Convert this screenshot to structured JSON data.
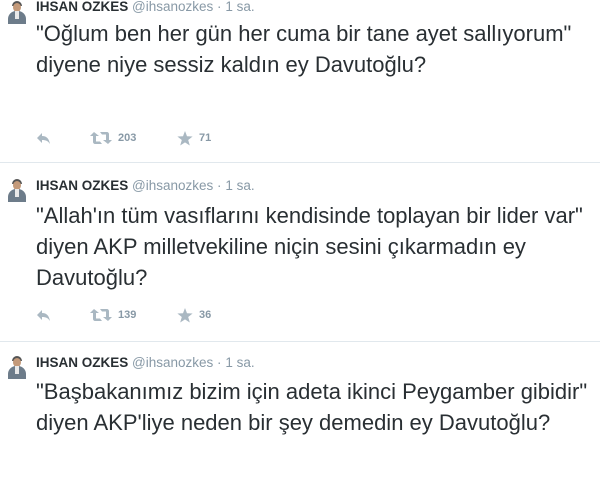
{
  "tweets": [
    {
      "author": "IHSAN OZKES",
      "handle": "@ihsanozkes",
      "separator": "·",
      "time": "1 sa.",
      "text": "\"Oğlum ben her gün her cuma bir tane ayet sallıyorum\" diyene niye sessiz kaldın ey Davutoğlu?",
      "retweets": "203",
      "favorites": "71"
    },
    {
      "author": "IHSAN OZKES",
      "handle": "@ihsanozkes",
      "separator": "·",
      "time": "1 sa.",
      "text": "\"Allah'ın tüm vasıflarını kendisinde toplayan bir lider var\" diyen AKP milletvekiline niçin sesini çıkarmadın ey Davutoğlu?",
      "retweets": "139",
      "favorites": "36"
    },
    {
      "author": "IHSAN OZKES",
      "handle": "@ihsanozkes",
      "separator": "·",
      "time": "1 sa.",
      "text": "\"Başbakanımız bizim için adeta ikinci Peygamber gibidir\" diyen AKP'liye neden bir şey demedin ey Davutoğlu?"
    }
  ],
  "icons": {
    "reply": "reply-icon",
    "retweet": "retweet-icon",
    "favorite": "star-icon",
    "avatar": "avatar"
  },
  "colors": {
    "text": "#292f33",
    "muted": "#8899a6",
    "icon": "#aab8c2",
    "divider": "#e1e8ed"
  }
}
